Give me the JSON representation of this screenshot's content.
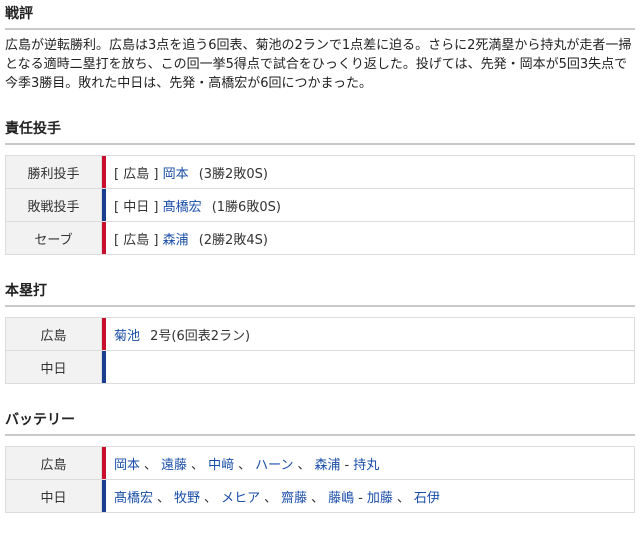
{
  "summary": {
    "title": "戦評",
    "text": "広島が逆転勝利。広島は3点を追う6回表、菊池の2ランで1点差に迫る。さらに2死満塁から持丸が走者一掃となる適時二塁打を放ち、この回一挙5得点で試合をひっくり返した。投げては、先発・岡本が5回3失点で今季3勝目。敗れた中日は、先発・高橋宏が6回につかまった。"
  },
  "pitchers": {
    "title": "責任投手",
    "rows": [
      {
        "label": "勝利投手",
        "team": "[ 広島 ]",
        "name": "岡本",
        "stat": "(3勝2敗0S)",
        "color": "#c8102e"
      },
      {
        "label": "敗戦投手",
        "team": "[ 中日 ]",
        "name": "髙橋宏",
        "stat": "(1勝6敗0S)",
        "color": "#1a3f8f"
      },
      {
        "label": "セーブ",
        "team": "[ 広島 ]",
        "name": "森浦",
        "stat": "(2勝2敗4S)",
        "color": "#c8102e"
      }
    ]
  },
  "homeruns": {
    "title": "本塁打",
    "rows": [
      {
        "label": "広島",
        "name": "菊池",
        "stat": "2号(6回表2ラン)",
        "color": "#c8102e"
      },
      {
        "label": "中日",
        "name": "",
        "stat": "",
        "color": "#1a3f8f"
      }
    ]
  },
  "battery": {
    "title": "バッテリー",
    "rows": [
      {
        "label": "広島",
        "pitchers": [
          "岡本",
          "遠藤",
          "中﨑",
          "ハーン",
          "森浦"
        ],
        "catcher_sep": "-",
        "catchers": [
          "持丸"
        ],
        "color": "#c8102e"
      },
      {
        "label": "中日",
        "pitchers": [
          "髙橋宏",
          "牧野",
          "メヒア",
          "齋藤",
          "藤嶋"
        ],
        "catcher_sep": "-",
        "catchers": [
          "加藤",
          "石伊"
        ],
        "color": "#1a3f8f"
      }
    ]
  }
}
